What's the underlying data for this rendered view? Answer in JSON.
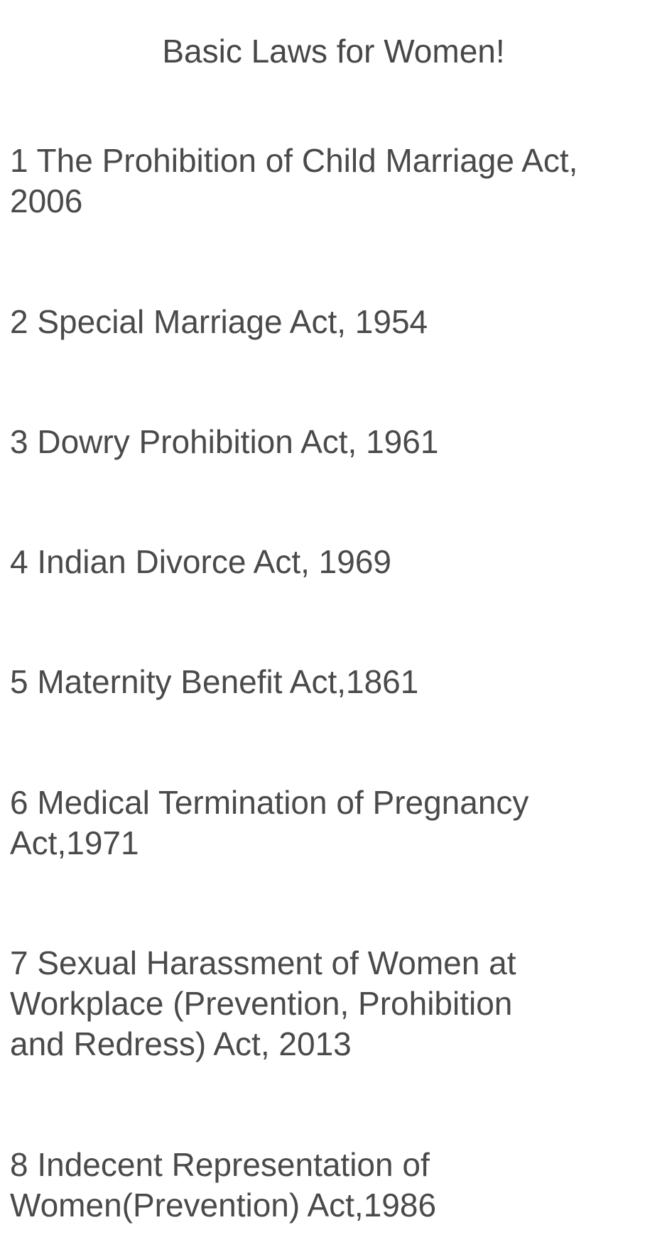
{
  "title": "Basic Laws for Women!",
  "items": [
    {
      "text": "1 The Prohibition of Child Marriage Act,\n2006"
    },
    {
      "text": "2 Special Marriage Act, 1954"
    },
    {
      "text": "3 Dowry Prohibition Act, 1961"
    },
    {
      "text": "4 Indian Divorce Act, 1969"
    },
    {
      "text": "5 Maternity Benefit Act,1861"
    },
    {
      "text": "6 Medical Termination of Pregnancy\nAct,1971"
    },
    {
      "text": "7 Sexual Harassment of Women at\nWorkplace (Prevention, Prohibition\nand Redress) Act, 2013"
    },
    {
      "text": "8 Indecent Representation of\nWomen(Prevention) Act,1986"
    }
  ]
}
